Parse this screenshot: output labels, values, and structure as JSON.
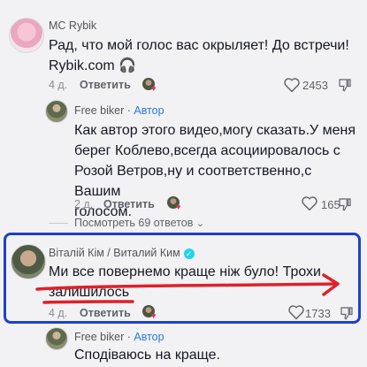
{
  "comments": [
    {
      "author": "MC Rybik",
      "text": "Рад, что мой голос вас окрыляет! До встречи! Rybik.com 🎧",
      "age": "4 д.",
      "reply_label": "Ответить",
      "likes": "2453"
    },
    {
      "author": "Free biker",
      "author_tag": "Автор",
      "text_lines": [
        "Как автор этого видео,могу сказать.У меня",
        "берег Коблево,всегда асоциировалось с",
        "Розой Ветров,ну и соответственно,с Вашим",
        "голосом."
      ],
      "age": "2 д.",
      "reply_label": "Ответить",
      "likes": "165"
    },
    {
      "author": "Віталій Кім / Виталий Ким",
      "verified": "✓",
      "text_lines": [
        "Ми все повернемо краще ніж було! Трохи",
        "залишилось"
      ],
      "age": "4 д.",
      "reply_label": "Ответить",
      "likes": "1733"
    },
    {
      "author": "Free biker",
      "author_tag": "Автор",
      "text": "Сподіваюсь на краще."
    }
  ],
  "view_replies": "Посмотреть 69 ответов",
  "colors": {
    "highlight_box": "#1e41c9",
    "underline": "#e0202a",
    "author_tag": "#2b7bd8",
    "background": "#f2f2f4"
  },
  "icons": {
    "like": "heart-outline-icon",
    "dislike": "thumbs-down-outline-icon",
    "creator_liked": "liked-by-creator-icon",
    "expand": "chevron-down-icon",
    "headphones": "headphones-icon",
    "verified": "verified-badge-icon"
  }
}
